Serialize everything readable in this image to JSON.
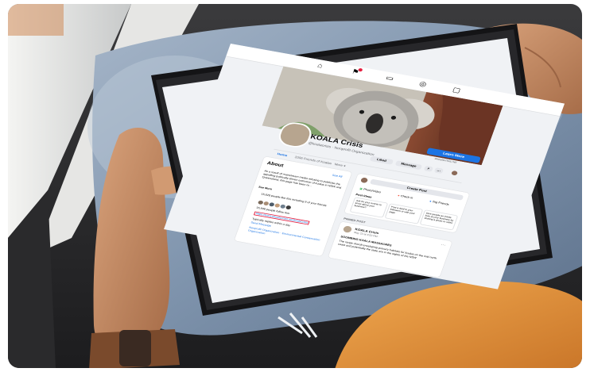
{
  "page": {
    "name": "KOALA Crisis",
    "handle_category": "@koalacrisis · Nonprofit Organization",
    "cta_label": "Learn More",
    "cta_sub": "ekoalacrisis.net",
    "like_label": "Liked",
    "message_label": "Message",
    "tabs": [
      "Home",
      "2006 Friends of Koalas",
      "More ▾"
    ]
  },
  "about": {
    "title": "About",
    "see_all": "See All",
    "description": "As a result of mainstream media refusing to publicise the appalling politically-driven extinction of koalas in NSW and Queensland, this page has been re...",
    "see_more": "See More",
    "likes_line": "15,620 people like this including 9 of your friends",
    "followers_line": "15,938 people follow this",
    "website": "https://www.ekoalacrisis.net/koalacrisis",
    "response_line": "Typically replies within a day",
    "send_message": "Send Message",
    "categories": "Nonprofit Organization · Environmental Conservation Organization"
  },
  "composer": {
    "title": "Create Post",
    "photo_video": "Photo/Video",
    "checkin": "Check in",
    "tag_friends": "Tag Friends",
    "post_ideas_label": "Post Ideas",
    "ideas": [
      "Ask for your events to know about your business?",
      "Post a deal to your followers or with your page",
      "Give people an inside look at your business by sharing a photo or video"
    ]
  },
  "pinned": {
    "label": "PINNED POST",
    "author": "KOALA Crisis",
    "time": "May 23 at 3:52 PM ·",
    "headline": "SOOMBING KOALA MASSACRES",
    "body": "The range clocult enveloping primary habitats for koalas on the mid north coast and potentially the state are in the sights of the NSW"
  },
  "colors": {
    "fb_blue": "#1b74e4",
    "bg": "#f0f2f5",
    "orange_shirt": "#e8953c",
    "denim": "#7f94ad"
  }
}
